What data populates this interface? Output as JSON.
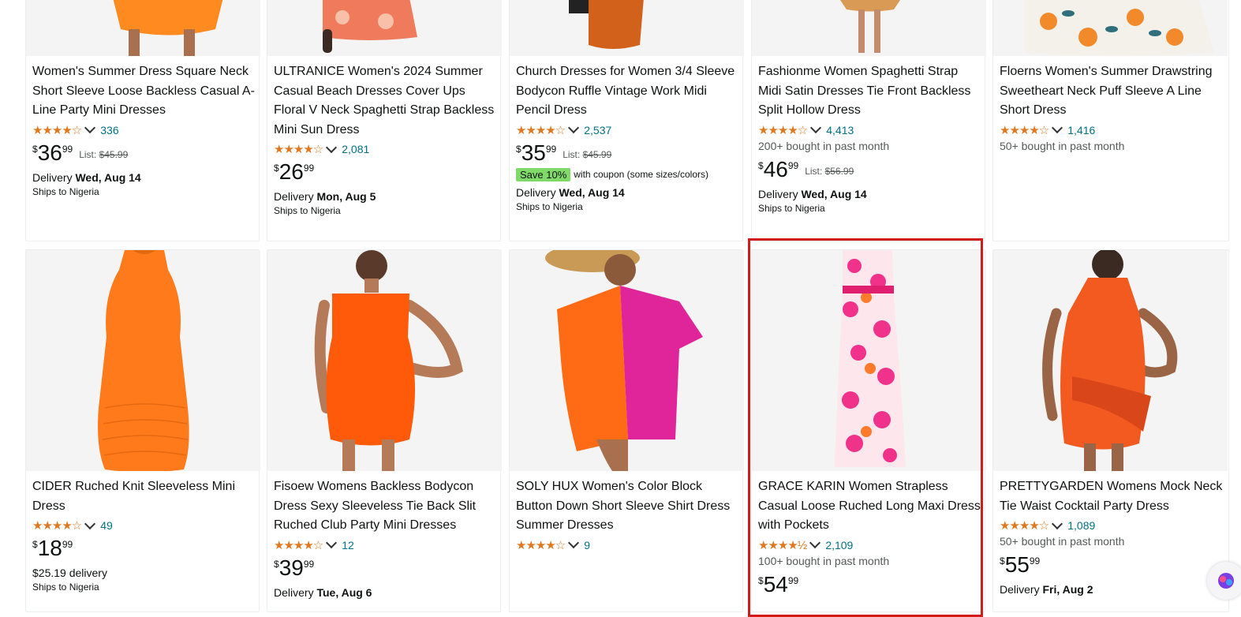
{
  "products": [
    {
      "title": "Women's Summer Dress Square Neck Short Sleeve Loose Backless Casual A-Line Party Mini Dresses",
      "stars": "★★★★☆",
      "count": "336",
      "price_symbol": "$",
      "price_whole": "36",
      "price_fraction": "99",
      "list_label": "List:",
      "list_price": "$45.99",
      "delivery_label": "Delivery",
      "delivery_date": "Wed, Aug 14",
      "ships": "Ships to Nigeria"
    },
    {
      "title": "ULTRANICE Women's 2024 Summer Casual Beach Dresses Cover Ups Floral V Neck Spaghetti Strap Backless Mini Sun Dress",
      "stars": "★★★★☆",
      "count": "2,081",
      "price_symbol": "$",
      "price_whole": "26",
      "price_fraction": "99",
      "delivery_label": "Delivery",
      "delivery_date": "Mon, Aug 5",
      "ships": "Ships to Nigeria"
    },
    {
      "title": "Church Dresses for Women 3/4 Sleeve Bodycon Ruffle Vintage Work Midi Pencil Dress",
      "stars": "★★★★☆",
      "count": "2,537",
      "price_symbol": "$",
      "price_whole": "35",
      "price_fraction": "99",
      "list_label": "List:",
      "list_price": "$45.99",
      "coupon_badge": "Save 10%",
      "coupon_text": "with coupon (some sizes/colors)",
      "delivery_label": "Delivery",
      "delivery_date": "Wed, Aug 14",
      "ships": "Ships to Nigeria"
    },
    {
      "title": "Fashionme Women Spaghetti Strap Midi Satin Dresses Tie Front Backless Split Hollow Dress",
      "stars": "★★★★☆",
      "count": "4,413",
      "bought": "200+ bought in past month",
      "price_symbol": "$",
      "price_whole": "46",
      "price_fraction": "99",
      "list_label": "List:",
      "list_price": "$56.99",
      "delivery_label": "Delivery",
      "delivery_date": "Wed, Aug 14",
      "ships": "Ships to Nigeria"
    },
    {
      "title": "Floerns Women's Summer Drawstring Sweetheart Neck Puff Sleeve A Line Short Dress",
      "stars": "★★★★☆",
      "count": "1,416",
      "bought": "50+ bought in past month"
    },
    {
      "title": "CIDER Ruched Knit Sleeveless Mini Dress",
      "stars": "★★★★☆",
      "count": "49",
      "price_symbol": "$",
      "price_whole": "18",
      "price_fraction": "99",
      "delivery_fee": "$25.19 delivery",
      "ships": "Ships to Nigeria"
    },
    {
      "title": "Fisoew Womens Backless Bodycon Dress Sexy Sleeveless Tie Back Slit Ruched Club Party Mini Dresses",
      "stars": "★★★★☆",
      "count": "12",
      "price_symbol": "$",
      "price_whole": "39",
      "price_fraction": "99",
      "delivery_label": "Delivery",
      "delivery_date": "Tue, Aug 6"
    },
    {
      "title": "SOLY HUX Women's Color Block Button Down Short Sleeve Shirt Dress Summer Dresses",
      "stars": "★★★★☆",
      "count": "9"
    },
    {
      "title": "GRACE KARIN Women Strapless Casual Loose Ruched Long Maxi Dress with Pockets",
      "stars": "★★★★½",
      "count": "2,109",
      "bought": "100+ bought in past month",
      "price_symbol": "$",
      "price_whole": "54",
      "price_fraction": "99"
    },
    {
      "title": "PRETTYGARDEN Womens Mock Neck Tie Waist Cocktail Party Dress",
      "stars": "★★★★☆",
      "count": "1,089",
      "bought": "50+ bought in past month",
      "price_symbol": "$",
      "price_whole": "55",
      "price_fraction": "99",
      "delivery_label": "Delivery",
      "delivery_date": "Fri, Aug 2"
    }
  ],
  "colors": {
    "star": "#de7921",
    "link": "#007185",
    "coupon_badge": "#7fda69",
    "highlight": "#d21c1c",
    "dress_orange": "#f26b1d",
    "dress_pink": "#e0249a"
  },
  "icons": {
    "star": "star-icon",
    "chevron": "chevron-down-icon",
    "assistant": "assistant-bubble-icon"
  }
}
